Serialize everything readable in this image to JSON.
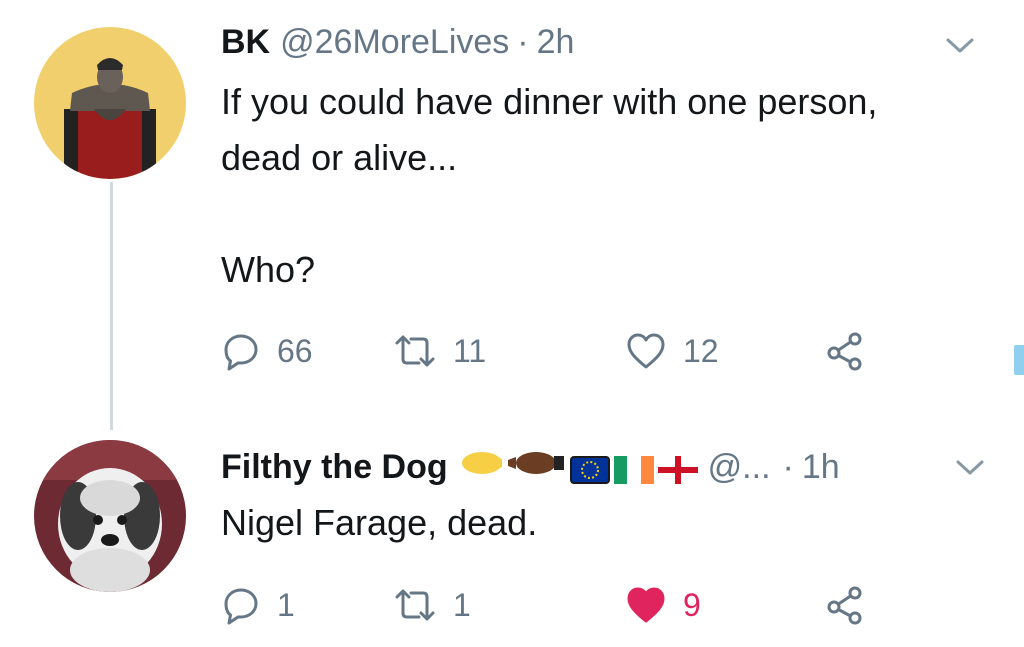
{
  "tweet1": {
    "display_name": "BK",
    "handle": "@26MoreLives",
    "separator": "·",
    "time": "2h",
    "text_line1": "If you could have dinner with one person,",
    "text_line2": "dead or alive...",
    "text_line3": "Who?",
    "actions": {
      "reply_count": "66",
      "retweet_count": "11",
      "like_count": "12"
    },
    "icons": {
      "reply": "reply-icon",
      "retweet": "retweet-icon",
      "like": "heart-outline-icon",
      "share": "share-icon",
      "menu": "chevron-down-icon"
    }
  },
  "tweet2": {
    "display_name": "Filthy the Dog",
    "handle": "@...",
    "separator": "·",
    "time": "1h",
    "text": "Nigel Farage, dead.",
    "actions": {
      "reply_count": "1",
      "retweet_count": "1",
      "like_count": "9"
    },
    "name_emojis": [
      "fist-bump-emoji",
      "eu-flag-emoji",
      "ireland-flag-emoji",
      "england-flag-emoji"
    ],
    "icons": {
      "reply": "reply-icon",
      "retweet": "retweet-icon",
      "like": "heart-filled-icon",
      "share": "share-icon",
      "menu": "chevron-down-icon"
    }
  },
  "colors": {
    "text_primary": "#14171a",
    "text_secondary": "#657786",
    "like_active": "#e0245e",
    "thread_line": "#cfd9de"
  }
}
